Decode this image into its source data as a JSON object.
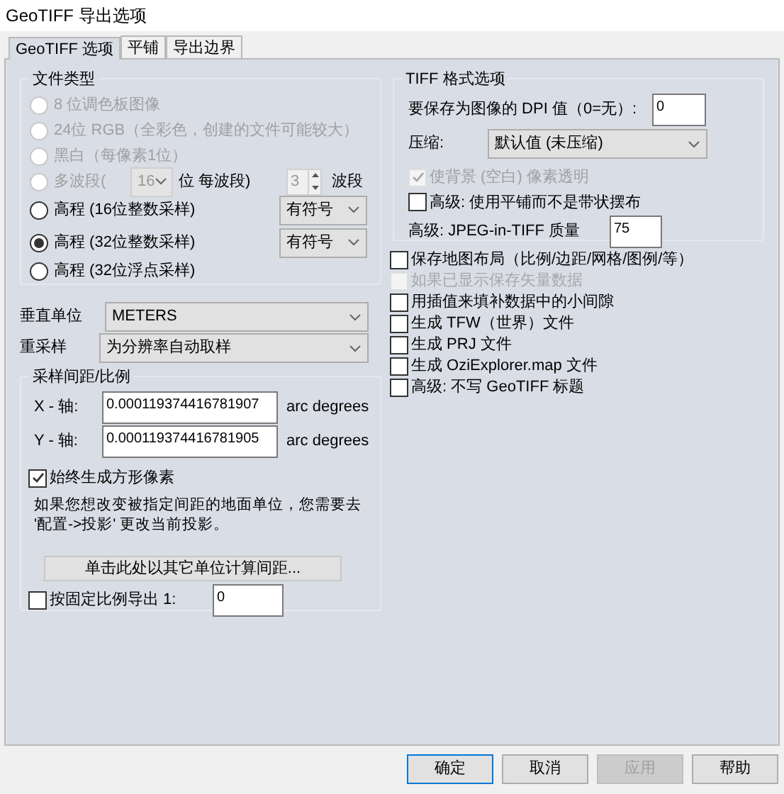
{
  "window": {
    "title": "GeoTIFF 导出选项"
  },
  "tabs": [
    {
      "label": "GeoTIFF 选项",
      "selected": true
    },
    {
      "label": "平铺",
      "selected": false
    },
    {
      "label": "导出边界",
      "selected": false
    }
  ],
  "file_type": {
    "title": "文件类型",
    "options": [
      {
        "kind": "plain",
        "label": "8 位调色板图像",
        "selected": false,
        "disabled": true
      },
      {
        "kind": "plain",
        "label": "24位 RGB（全彩色，创建的文件可能较大）",
        "selected": false,
        "disabled": true
      },
      {
        "kind": "plain",
        "label": "黑白（每像素1位）",
        "selected": false,
        "disabled": true
      },
      {
        "kind": "multiband",
        "label": "多波段(",
        "selected": false,
        "disabled": true,
        "bits": "16",
        "bits_label": "位 每波段)",
        "bands": "3",
        "bands_label": "波段"
      },
      {
        "kind": "signed",
        "label": "高程 (16位整数采样)",
        "selected": false,
        "disabled": false,
        "sign": "有符号"
      },
      {
        "kind": "signed",
        "label": "高程 (32位整数采样)",
        "selected": true,
        "disabled": false,
        "sign": "有符号"
      },
      {
        "kind": "plain",
        "label": "高程 (32位浮点采样)",
        "selected": false,
        "disabled": false
      }
    ]
  },
  "vertical_unit": {
    "label": "垂直单位",
    "value": "METERS"
  },
  "resample": {
    "label": "重采样",
    "value": "为分辨率自动取样"
  },
  "spacing": {
    "title": "采样间距/比例",
    "x": {
      "label": "X - 轴:",
      "value": "0.000119374416781907",
      "unit": "arc degrees"
    },
    "y": {
      "label": "Y - 轴:",
      "value": "0.000119374416781905",
      "unit": "arc degrees"
    },
    "square": {
      "label": "始终生成方形像素",
      "checked": true
    },
    "note": "如果您想改变被指定间距的地面单位，您需要去 '配置->投影' 更改当前投影。",
    "button": "单击此处以其它单位计算间距...",
    "fixed_scale": {
      "label": "按固定比例导出 1:",
      "checked": false,
      "value": "0"
    }
  },
  "tiff": {
    "title": "TIFF 格式选项",
    "dpi": {
      "label": "要保存为图像的 DPI 值（0=无）:",
      "value": "0"
    },
    "compression": {
      "label": "压缩:",
      "value": "默认值 (未压缩)"
    },
    "transparent": {
      "label": "使背景 (空白) 像素透明",
      "checked": true,
      "disabled": true
    },
    "tiled": {
      "label": "高级: 使用平铺而不是带状摆布",
      "checked": false
    },
    "jpeg": {
      "label": "高级: JPEG-in-TIFF 质量",
      "value": "75"
    }
  },
  "options": [
    {
      "label": "保存地图布局（比例/边距/网格/图例/等）",
      "checked": false,
      "disabled": false
    },
    {
      "label": "如果已显示保存矢量数据",
      "checked": false,
      "disabled": true
    },
    {
      "label": "用插值来填补数据中的小间隙",
      "checked": false,
      "disabled": false
    },
    {
      "label": "生成 TFW（世界）文件",
      "checked": false,
      "disabled": false
    },
    {
      "label": "生成 PRJ 文件",
      "checked": false,
      "disabled": false
    },
    {
      "label": "生成 OziExplorer.map 文件",
      "checked": false,
      "disabled": false
    },
    {
      "label": "高级: 不写 GeoTIFF 标题",
      "checked": false,
      "disabled": false
    }
  ],
  "buttons": [
    {
      "label": "确定",
      "default": true,
      "disabled": false
    },
    {
      "label": "取消",
      "default": false,
      "disabled": false
    },
    {
      "label": "应用",
      "default": false,
      "disabled": true
    },
    {
      "label": "帮助",
      "default": false,
      "disabled": false
    }
  ]
}
